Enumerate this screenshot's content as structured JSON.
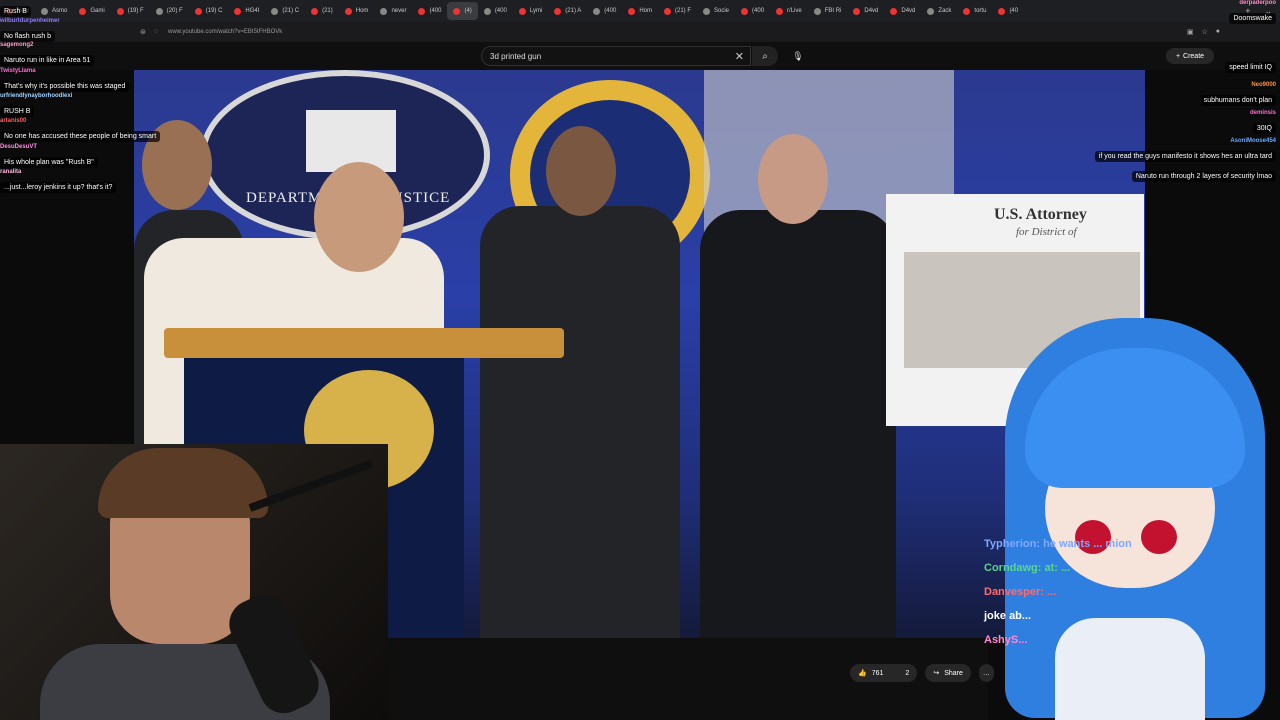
{
  "browser": {
    "tabs": [
      {
        "label": "New",
        "active": false
      },
      {
        "label": "Asmo",
        "active": false
      },
      {
        "label": "Gami",
        "active": false
      },
      {
        "label": "(19) F",
        "active": false
      },
      {
        "label": "(20) F",
        "active": false
      },
      {
        "label": "(19) C",
        "active": false
      },
      {
        "label": "HG4I",
        "active": false
      },
      {
        "label": "(21) C",
        "active": false
      },
      {
        "label": "(21)",
        "active": false
      },
      {
        "label": "Hom",
        "active": false
      },
      {
        "label": "never",
        "active": false
      },
      {
        "label": "(400",
        "active": false
      },
      {
        "label": "(4)",
        "active": true
      },
      {
        "label": "(400",
        "active": false
      },
      {
        "label": "Lymi",
        "active": false
      },
      {
        "label": "(21) A",
        "active": false
      },
      {
        "label": "(400",
        "active": false
      },
      {
        "label": "Hom",
        "active": false
      },
      {
        "label": "(21) F",
        "active": false
      },
      {
        "label": "Socie",
        "active": false
      },
      {
        "label": "(400",
        "active": false
      },
      {
        "label": "r/Live",
        "active": false
      },
      {
        "label": "FBI Ri",
        "active": false
      },
      {
        "label": "D4vd",
        "active": false
      },
      {
        "label": "D4vd",
        "active": false
      },
      {
        "label": "Zack",
        "active": false
      },
      {
        "label": "tortu",
        "active": false
      },
      {
        "label": "(40",
        "active": false
      }
    ],
    "url": "www.youtube.com/watch?v=EBI5tFHBOVk"
  },
  "youtube": {
    "search_query": "3d printed gun",
    "create_label": "Create",
    "like_count": "761",
    "dislike_count": "2",
    "share_label": "Share"
  },
  "video": {
    "seal_text": "DEPARTMENT OF JUSTICE",
    "board_title": "U.S. Attorney",
    "board_subtitle": "for District of"
  },
  "chat_left": [
    {
      "name": "",
      "color": "#ffffff",
      "text": "Rush B"
    },
    {
      "name": "wilburtdurpenheimer",
      "color": "#8a7cff",
      "text": "No flash rush b"
    },
    {
      "name": "sagemong2",
      "color": "#ff9acd",
      "text": "Naruto run in like in Area 51"
    },
    {
      "name": "TwistyLlama",
      "color": "#ff6bd2",
      "text": "That's why it's possible this was staged"
    },
    {
      "name": "urfriendlynayborhoodlexi",
      "color": "#9fd3ff",
      "text": "RUSH B"
    },
    {
      "name": "artanis00",
      "color": "#ff5b5b",
      "text": "No one has accused these people of being smart"
    },
    {
      "name": "DesuDesuVT",
      "color": "#ff8be0",
      "text": "His whole plan was \"Rush B\""
    },
    {
      "name": "ranalita",
      "color": "#ffb3de",
      "text": "...just...leroy jenkins it up? that's it?"
    }
  ],
  "chat_right": [
    {
      "name": "derpaderpoo",
      "color": "#ff89c8",
      "text": "Doomswake"
    },
    {
      "name": "",
      "color": "#ffffff",
      "text": "speed limit IQ"
    },
    {
      "name": "Neo9000",
      "color": "#ff8f4a",
      "text": "subhumans don't plan"
    },
    {
      "name": "deminsis",
      "color": "#ff6bd2",
      "text": "30IQ"
    },
    {
      "name": "AsoniMoose454",
      "color": "#6aa8ff",
      "text": "if you read the guys manifesto it shows hes an ultra tard"
    },
    {
      "name": "",
      "color": "#ffffff",
      "text": "Naruto run through 2 layers of security lmao"
    }
  ],
  "overlay_chat": [
    {
      "text": "Typherion: he wants ... mion",
      "color": "#7fa8ff"
    },
    {
      "text": "Corndawg: at: ...",
      "color": "#58d68d"
    },
    {
      "text": "Danvesper: ...",
      "color": "#ff6b6b"
    },
    {
      "text": "joke ab...",
      "color": "#ffffff"
    },
    {
      "text": "AshyS...",
      "color": "#ff89d6"
    }
  ]
}
